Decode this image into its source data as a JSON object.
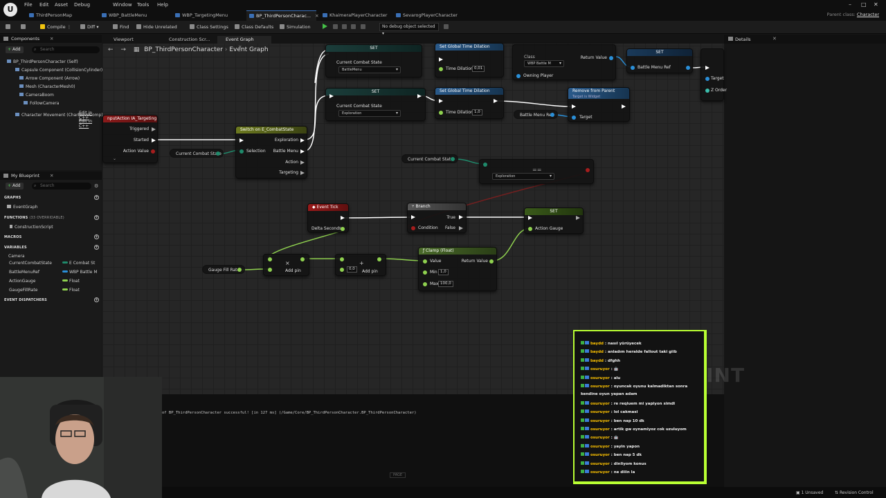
{
  "menu": {
    "items": [
      "File",
      "Edit",
      "Asset",
      "Debug",
      "Window",
      "Tools",
      "Help"
    ]
  },
  "tabs": [
    {
      "label": "ThirdPersonMap",
      "active": false
    },
    {
      "label": "WBP_BattleMenu",
      "active": false
    },
    {
      "label": "WBP_TargetingMenu",
      "active": false
    },
    {
      "label": "BP_ThirdPersonCharac...",
      "active": true
    },
    {
      "label": "KhaimeraPlayerCharacter",
      "active": false
    },
    {
      "label": "SevarogPlayerCharacter",
      "active": false
    }
  ],
  "parent_class": {
    "label": "Parent class:",
    "value": "Character"
  },
  "toolbar": {
    "compile": "Compile",
    "diff": "Diff",
    "find": "Find",
    "hide_unrelated": "Hide Unrelated",
    "class_settings": "Class Settings",
    "class_defaults": "Class Defaults",
    "simulation": "Simulation",
    "debug_object": "No debug object selected"
  },
  "components_panel": {
    "title": "Components",
    "add": "Add",
    "search_placeholder": "Search",
    "items": [
      {
        "label": "BP_ThirdPersonCharacter (Self)"
      },
      {
        "label": "Capsule Component (CollisionCylinder)"
      },
      {
        "label": "Arrow Component (Arrow)",
        "edit": "Edit in C++"
      },
      {
        "label": "Mesh (CharacterMesh0)",
        "edit": "Edit in C++"
      },
      {
        "label": "CameraBoom"
      },
      {
        "label": "FollowCamera"
      },
      {
        "label": "Character Movement (CharMoveComp)"
      }
    ]
  },
  "my_blueprint": {
    "title": "My Blueprint",
    "add": "Add",
    "search_placeholder": "Search",
    "sections": {
      "graphs": "GRAPHS",
      "functions": "FUNCTIONS",
      "functions_sub": "(33 OVERRIDABLE)",
      "macros": "MACROS",
      "variables": "VARIABLES",
      "dispatchers": "EVENT DISPATCHERS"
    },
    "graph_items": [
      "EventGraph"
    ],
    "function_items": [
      "ConstructionScript"
    ],
    "variable_category": "Camera",
    "variables": [
      {
        "name": "CurrentCombatState",
        "type": "E Combat St",
        "color": "#1f8a6b"
      },
      {
        "name": "BattleMenuRef",
        "type": "WBP Battle M",
        "color": "#2a8fd8"
      },
      {
        "name": "ActionGauge",
        "type": "Float",
        "color": "#8fd14f"
      },
      {
        "name": "GaugeFillRate",
        "type": "Float",
        "color": "#8fd14f"
      }
    ]
  },
  "graph_tabs": {
    "viewport": "Viewport",
    "construction": "Construction Scr...",
    "event_graph": "Event Graph"
  },
  "breadcrumb": {
    "root": "BP_ThirdPersonCharacter",
    "current": "Event Graph"
  },
  "watermark": "BLUEPRINT",
  "nodes": {
    "input_action": {
      "title": "nputAction IA_Targeting",
      "triggered": "Triggered",
      "started": "Started",
      "action_value": "Action Value"
    },
    "get_combat_state_1": "Current Combat State",
    "switch": {
      "title": "Switch on E_CombatState",
      "exploration": "Exploration",
      "selection": "Selection",
      "battle_menu": "Battle Menu",
      "action": "Action",
      "targeting": "Targeting"
    },
    "set_top": {
      "title": "SET",
      "pin": "Current Combat State",
      "value": "BattleMenu"
    },
    "set_mid": {
      "title": "SET",
      "pin": "Current Combat State",
      "value": "Exploration"
    },
    "time_dilation_top": {
      "title": "Set Global Time Dilation",
      "pin": "Time Dilation",
      "value": "0,01"
    },
    "time_dilation_mid": {
      "title": "Set Global Time Dilation",
      "pin": "Time Dilation",
      "value": "1,0"
    },
    "create_widget": {
      "class_label": "Class",
      "class_value": "WBP Battle M",
      "owning_player": "Owning Player",
      "return_value": "Return Value"
    },
    "set_battle_menu": {
      "title": "SET",
      "pin": "Battle Menu Ref",
      "target": "Target",
      "zorder": "Z Order"
    },
    "remove_from_parent": {
      "title": "Remove from Parent",
      "subtitle": "Target is Widget",
      "target": "Target"
    },
    "battle_menu_ref_get": "Battle Menu Ref",
    "get_combat_state_2": "Current Combat State",
    "equal_node": {
      "value": "Exploration"
    },
    "event_tick": {
      "title": "Event Tick",
      "delta": "Delta Seconds"
    },
    "branch": {
      "title": "Branch",
      "condition": "Condition",
      "true_label": "True",
      "false_label": "False"
    },
    "set_gauge": {
      "title": "SET",
      "pin": "Action Gauge"
    },
    "multiply": {
      "add_pin": "Add pin"
    },
    "add": {
      "value": "0,0",
      "add_pin": "Add pin"
    },
    "clamp": {
      "title": "Clamp (Float)",
      "value": "Value",
      "min": "Min",
      "min_value": "1,0",
      "max": "Max",
      "max_value": "100,0",
      "return_value": "Return Value"
    },
    "gauge_fill_rate_get": "Gauge Fill Rate"
  },
  "details": {
    "title": "Details"
  },
  "log": {
    "line": "of BP_ThirdPersonCharacter successful! [in 127 ms] (/Game/Core/BP_ThirdPersonCharacter.BP_ThirdPersonCharacter)",
    "page": "PAGE"
  },
  "status": {
    "unsaved": "1 Unsaved",
    "revision": "Revision Control"
  },
  "chat": {
    "messages": [
      {
        "user": "baydd",
        "text": "nasıl yürüyecek"
      },
      {
        "user": "baydd",
        "text": "anladım heralde fallout taki giib"
      },
      {
        "user": "baydd",
        "text": "dfghh"
      },
      {
        "user": "osuruyor",
        "text": "🤖"
      },
      {
        "user": "osuruyor",
        "text": "alu"
      },
      {
        "user": "osuruyor",
        "text": "oyuncak oyunu kalmadiktan sonra"
      },
      {
        "user": "",
        "text": "kendine oyun yapan adam"
      },
      {
        "user": "osuruyor",
        "text": "re reqiuem mi yapiyon simdi"
      },
      {
        "user": "osuruyor",
        "text": "lol cakmasi"
      },
      {
        "user": "osuruyor",
        "text": "ben nap 10 dk"
      },
      {
        "user": "osuruyor",
        "text": "artik gw oynamiyoz cok uzuluyom"
      },
      {
        "user": "osuruyor",
        "text": "🤖"
      },
      {
        "user": "osuruyor",
        "text": "yayin yapon"
      },
      {
        "user": "osuruyor",
        "text": "ben nap 5 dk"
      },
      {
        "user": "osuruyor",
        "text": "dinliyom konus"
      },
      {
        "user": "osuruyor",
        "text": "ne diiin la"
      }
    ]
  },
  "colors": {
    "exec": "#ffffff",
    "float": "#8fd14f",
    "enum": "#1f8a6b",
    "object": "#2a8fd8",
    "bool": "#a51d1d",
    "chat_border": "#b9ff33"
  }
}
